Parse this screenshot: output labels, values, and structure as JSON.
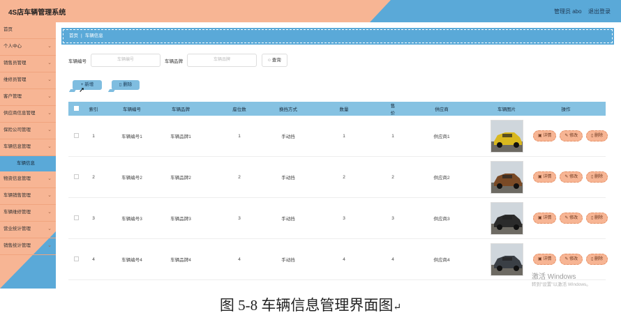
{
  "header": {
    "title": "4S店车辆管理系统",
    "user_text": "管理员 abo",
    "logout_label": "退出登录"
  },
  "sidebar": {
    "items": [
      {
        "label": "首页",
        "has_chevron": false
      },
      {
        "label": "个人中心",
        "has_chevron": true
      },
      {
        "label": "销售员管理",
        "has_chevron": true
      },
      {
        "label": "维修员管理",
        "has_chevron": true
      },
      {
        "label": "客户管理",
        "has_chevron": true
      },
      {
        "label": "供应商信息管理",
        "has_chevron": true
      },
      {
        "label": "保险公司管理",
        "has_chevron": true
      },
      {
        "label": "车辆信息管理",
        "has_chevron": true
      }
    ],
    "active_sub": "车辆信息",
    "items_after": [
      {
        "label": "物资信息管理",
        "has_chevron": true
      },
      {
        "label": "车辆销售管理",
        "has_chevron": true
      },
      {
        "label": "车辆维修管理",
        "has_chevron": true
      },
      {
        "label": "营业统计管理",
        "has_chevron": true
      },
      {
        "label": "销售统计管理",
        "has_chevron": true
      }
    ]
  },
  "breadcrumb": {
    "home": "首页",
    "separator": "|",
    "current": "车辆信息"
  },
  "search": {
    "vehicle_no_label": "车辆编号",
    "vehicle_no_placeholder": "车辆编号",
    "brand_label": "车辆品牌",
    "brand_placeholder": "车辆品牌",
    "query_label": "查询"
  },
  "actions": {
    "add_label": "新增",
    "delete_label": "删除"
  },
  "table": {
    "headers": {
      "index": "索引",
      "vehicle_no": "车辆编号",
      "brand": "车辆品牌",
      "seats": "座位数",
      "transmission": "换挡方式",
      "quantity": "数量",
      "price": "售价",
      "supplier": "供应商",
      "image": "车辆图片",
      "ops": "操作"
    },
    "rows": [
      {
        "index": "1",
        "vehicle_no": "车辆编号1",
        "brand": "车辆品牌1",
        "seats": "1",
        "transmission": "手动挡",
        "quantity": "1",
        "price": "1",
        "supplier": "供应商1"
      },
      {
        "index": "2",
        "vehicle_no": "车辆编号2",
        "brand": "车辆品牌2",
        "seats": "2",
        "transmission": "手动挡",
        "quantity": "2",
        "price": "2",
        "supplier": "供应商2"
      },
      {
        "index": "3",
        "vehicle_no": "车辆编号3",
        "brand": "车辆品牌3",
        "seats": "3",
        "transmission": "手动挡",
        "quantity": "3",
        "price": "3",
        "supplier": "供应商3"
      },
      {
        "index": "4",
        "vehicle_no": "车辆编号4",
        "brand": "车辆品牌4",
        "seats": "4",
        "transmission": "手动挡",
        "quantity": "4",
        "price": "4",
        "supplier": "供应商4"
      }
    ],
    "op_labels": {
      "detail": "详情",
      "edit": "修改",
      "delete": "删除"
    }
  },
  "watermark": {
    "line1": "激活 Windows",
    "line2": "转到\"设置\"以激活 Windows。"
  },
  "caption": "图 5-8 车辆信息管理界面图",
  "colors": {
    "peach": "#f7b594",
    "blue": "#5aa9d8",
    "table_header": "#86c2e2"
  }
}
